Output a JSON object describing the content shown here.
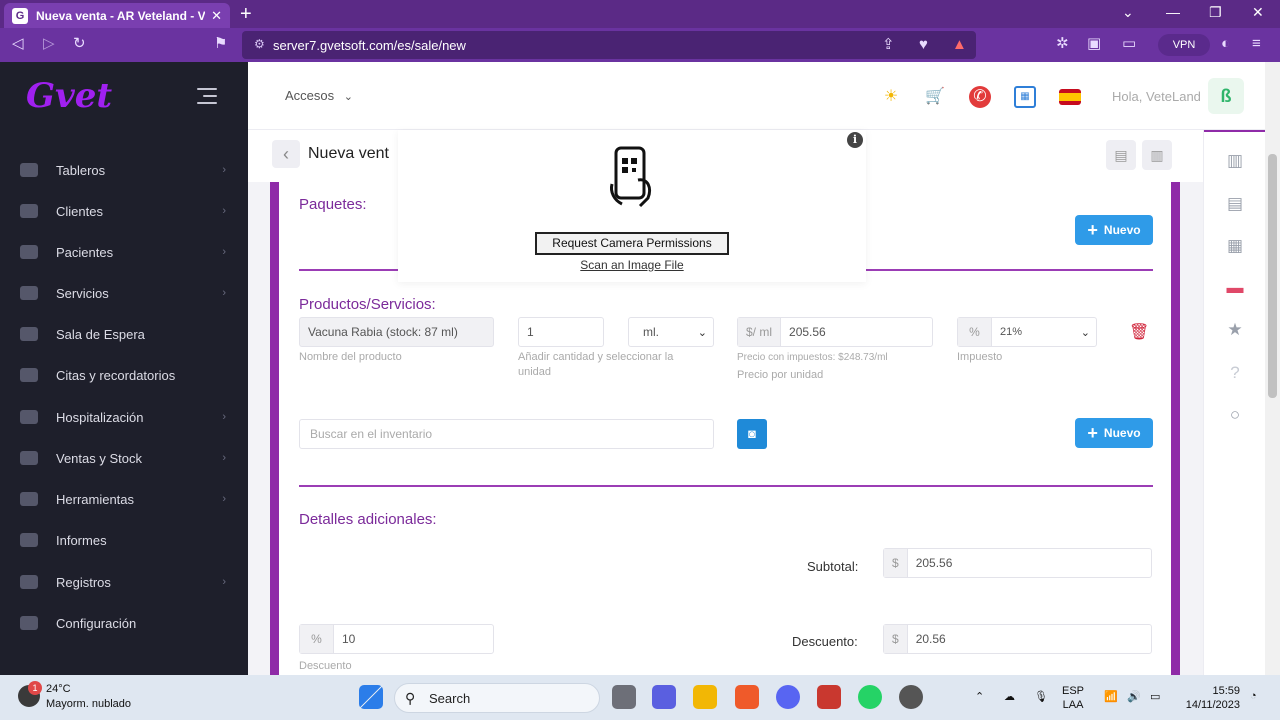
{
  "browser": {
    "tab_title": "Nueva venta - AR Veteland - Vete",
    "url": "server7.gvetsoft.com/es/sale/new",
    "vpn_label": "VPN"
  },
  "sidebar": {
    "logo": "Gvet",
    "items": [
      {
        "label": "Tableros",
        "chevron": true
      },
      {
        "label": "Clientes",
        "chevron": true
      },
      {
        "label": "Pacientes",
        "chevron": true
      },
      {
        "label": "Servicios",
        "chevron": true
      },
      {
        "label": "Sala de Espera",
        "chevron": false
      },
      {
        "label": "Citas y recordatorios",
        "chevron": false
      },
      {
        "label": "Hospitalización",
        "chevron": true
      },
      {
        "label": "Ventas y Stock",
        "chevron": true
      },
      {
        "label": "Herramientas",
        "chevron": true
      },
      {
        "label": "Informes",
        "chevron": false
      },
      {
        "label": "Registros",
        "chevron": true
      },
      {
        "label": "Configuración",
        "chevron": false
      }
    ]
  },
  "topbar": {
    "accesos": "Accesos",
    "greeting": "Hola, VeteLand"
  },
  "page": {
    "title": "Nueva vent"
  },
  "paquetes": {
    "title": "Paquetes:",
    "new_button": "Nuevo"
  },
  "productos": {
    "title": "Productos/Servicios:",
    "product_name": "Vacuna Rabia (stock: 87 ml)",
    "product_help": "Nombre del producto",
    "quantity": "1",
    "unit": "ml.",
    "quantity_help": "Añadir cantidad y seleccionar la unidad",
    "price_addon": "$/ ml",
    "price": "205.56",
    "price_tax_help": "Precio con impuestos: $248.73/ml",
    "price_help": "Precio por unidad",
    "tax_addon": "%",
    "tax": "21%",
    "tax_help": "Impuesto",
    "search_placeholder": "Buscar en el inventario",
    "new_button": "Nuevo"
  },
  "detalles": {
    "title": "Detalles adicionales:",
    "subtotal_label": "Subtotal:",
    "subtotal_addon": "$",
    "subtotal": "205.56",
    "discount_pct_addon": "%",
    "discount_pct": "10",
    "discount_help": "Descuento",
    "descuento_label": "Descuento:",
    "descuento_addon": "$",
    "descuento": "20.56"
  },
  "scanner_popup": {
    "request_button": "Request Camera Permissions",
    "scan_link": "Scan an Image File",
    "info": "i"
  },
  "taskbar": {
    "temperature": "24°C",
    "weather": "Mayorm. nublado",
    "weather_badge": "1",
    "search": "Search",
    "lang_top": "ESP",
    "lang_bottom": "LAA",
    "time": "15:59",
    "date": "14/11/2023"
  },
  "colors": {
    "accent_purple": "#8f2ba8",
    "button_blue": "#2f9be8",
    "delete_red": "#d0243a",
    "sidebar_bg": "#1e1f2b"
  }
}
